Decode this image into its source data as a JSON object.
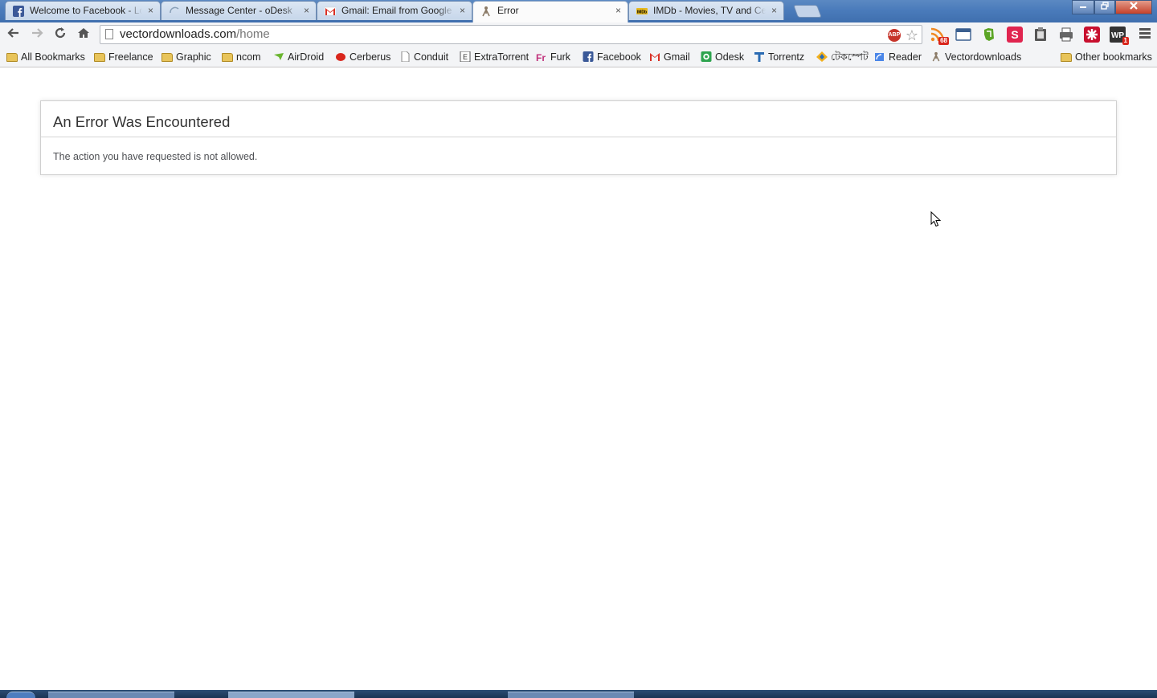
{
  "browser": {
    "tabs": [
      {
        "title": "Welcome to Facebook - Log In",
        "icon": "facebook-icon",
        "active": false
      },
      {
        "title": "Message Center - oDesk",
        "icon": "loading-icon",
        "active": false
      },
      {
        "title": "Gmail: Email from Google",
        "icon": "gmail-icon",
        "active": false
      },
      {
        "title": "Error",
        "icon": "vectordownloads-icon",
        "active": true
      },
      {
        "title": "IMDb - Movies, TV and Celebrities",
        "icon": "imdb-icon",
        "active": false
      }
    ],
    "close_glyph": "×",
    "url_host": "vectordownloads.com",
    "url_path": "/home",
    "extensions": [
      {
        "name": "rss-icon",
        "badge": "68"
      },
      {
        "name": "window-icon",
        "badge": ""
      },
      {
        "name": "evernote-icon",
        "badge": ""
      },
      {
        "name": "stumbleupon-icon",
        "badge": ""
      },
      {
        "name": "clipboard-icon",
        "badge": ""
      },
      {
        "name": "printer-icon",
        "badge": ""
      },
      {
        "name": "lastpass-icon",
        "badge": ""
      },
      {
        "name": "wordpress-icon",
        "badge": "1"
      }
    ]
  },
  "bookmarks": [
    {
      "label": "All Bookmarks",
      "icon": "folder-icon"
    },
    {
      "label": "Freelance",
      "icon": "folder-icon"
    },
    {
      "label": "Graphic",
      "icon": "folder-icon"
    },
    {
      "label": "ncom",
      "icon": "folder-icon"
    },
    {
      "label": "AirDroid",
      "icon": "airdroid-icon"
    },
    {
      "label": "Cerberus",
      "icon": "cerberus-icon"
    },
    {
      "label": "Conduit",
      "icon": "page-icon"
    },
    {
      "label": "ExtraTorrent",
      "icon": "extratorrent-icon"
    },
    {
      "label": "Furk",
      "icon": "furk-icon"
    },
    {
      "label": "Facebook",
      "icon": "facebook-icon"
    },
    {
      "label": "Gmail",
      "icon": "gmail-icon"
    },
    {
      "label": "Odesk",
      "icon": "odesk-icon"
    },
    {
      "label": "Torrentz",
      "icon": "torrentz-icon"
    },
    {
      "label": "টেকস্পেট",
      "icon": "techspot-icon"
    },
    {
      "label": "Reader",
      "icon": "reader-icon"
    },
    {
      "label": "Vectordownloads",
      "icon": "vectordownloads-icon"
    }
  ],
  "other_bookmarks": "Other bookmarks",
  "page": {
    "error_title": "An Error Was Encountered",
    "error_message": "The action you have requested is not allowed."
  }
}
